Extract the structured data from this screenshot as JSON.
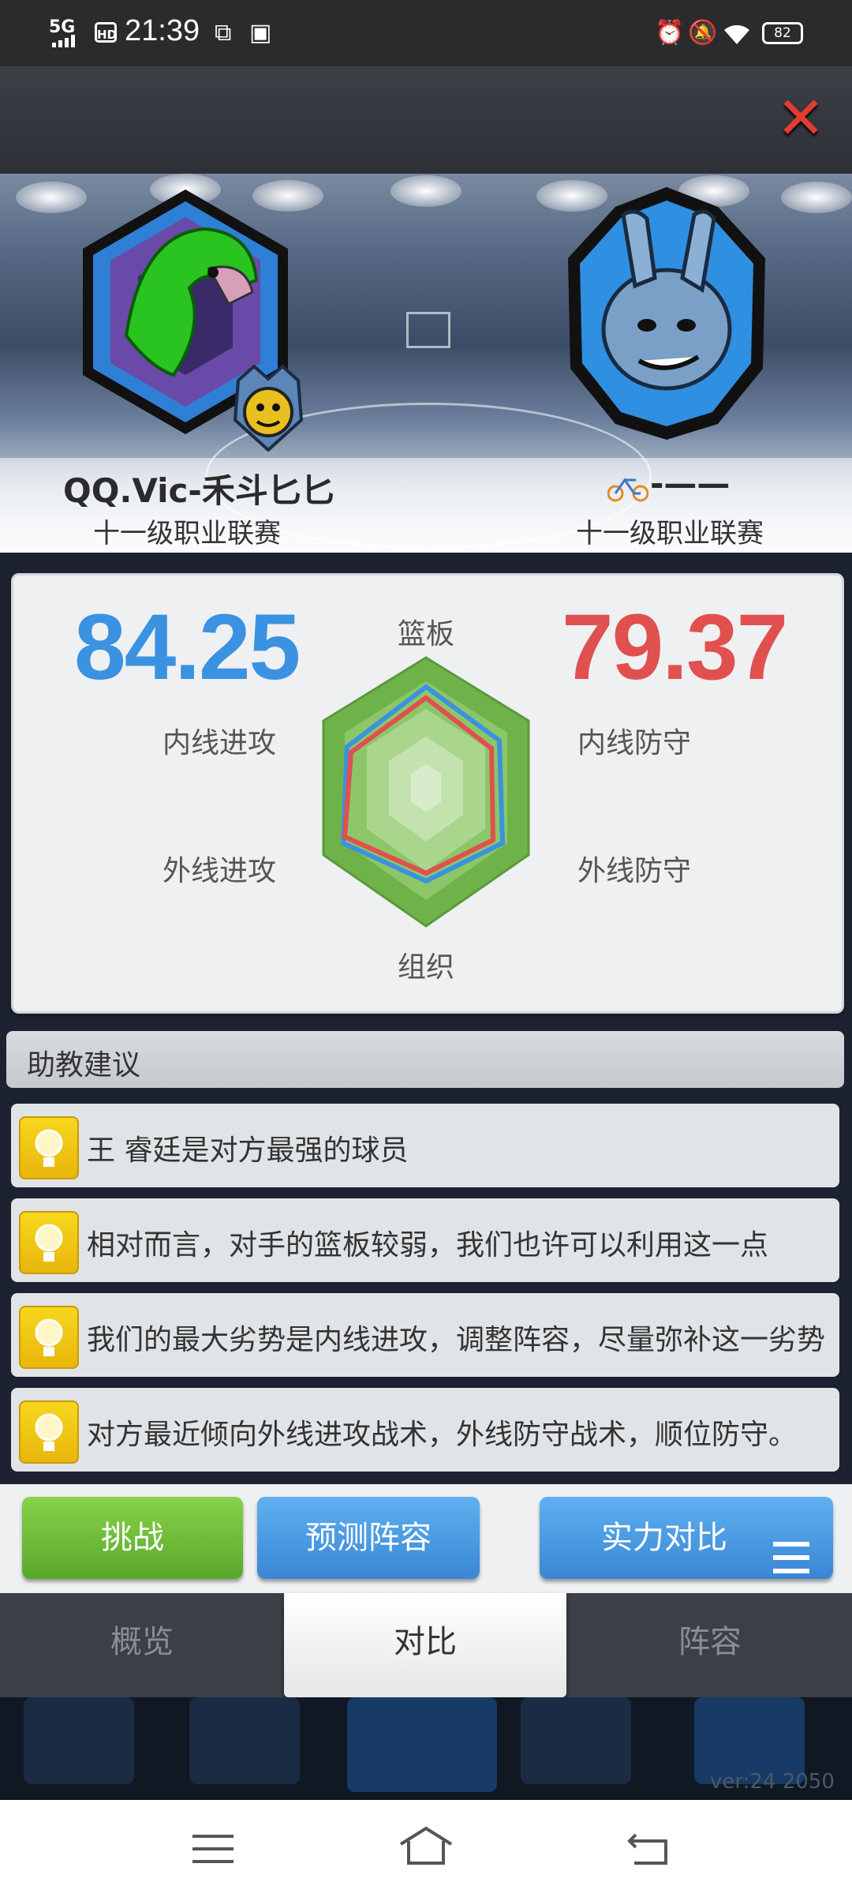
{
  "status_bar": {
    "signal": "5G",
    "hd": "HD",
    "time": "21:39",
    "battery": "82"
  },
  "home_team": {
    "name": "QQ.Vic-禾斗匕匕",
    "league": "十一级职业联赛"
  },
  "away_team": {
    "name": "-——",
    "league": "十一级职业联赛"
  },
  "comparison": {
    "home_score": "84.25",
    "away_score": "79.37",
    "home_color": "#3a92e0",
    "away_color": "#e0504f",
    "axes": {
      "top": "篮板",
      "upper_left": "内线进攻",
      "upper_right": "内线防守",
      "lower_left": "外线进攻",
      "lower_right": "外线防守",
      "bottom": "组织"
    }
  },
  "advice": {
    "title": "助教建议",
    "tips": [
      "王 睿廷是对方最强的球员",
      "相对而言，对手的篮板较弱，我们也许可以利用这一点",
      "我们的最大劣势是内线进攻，调整阵容，尽量弥补这一劣势",
      "对方最近倾向外线进攻战术，外线防守战术，顺位防守。"
    ]
  },
  "buttons": {
    "challenge": "挑战",
    "predict": "预测阵容",
    "strength": "实力对比"
  },
  "tabs": [
    "概览",
    "对比",
    "阵容"
  ],
  "version": "ver:24  2050"
}
